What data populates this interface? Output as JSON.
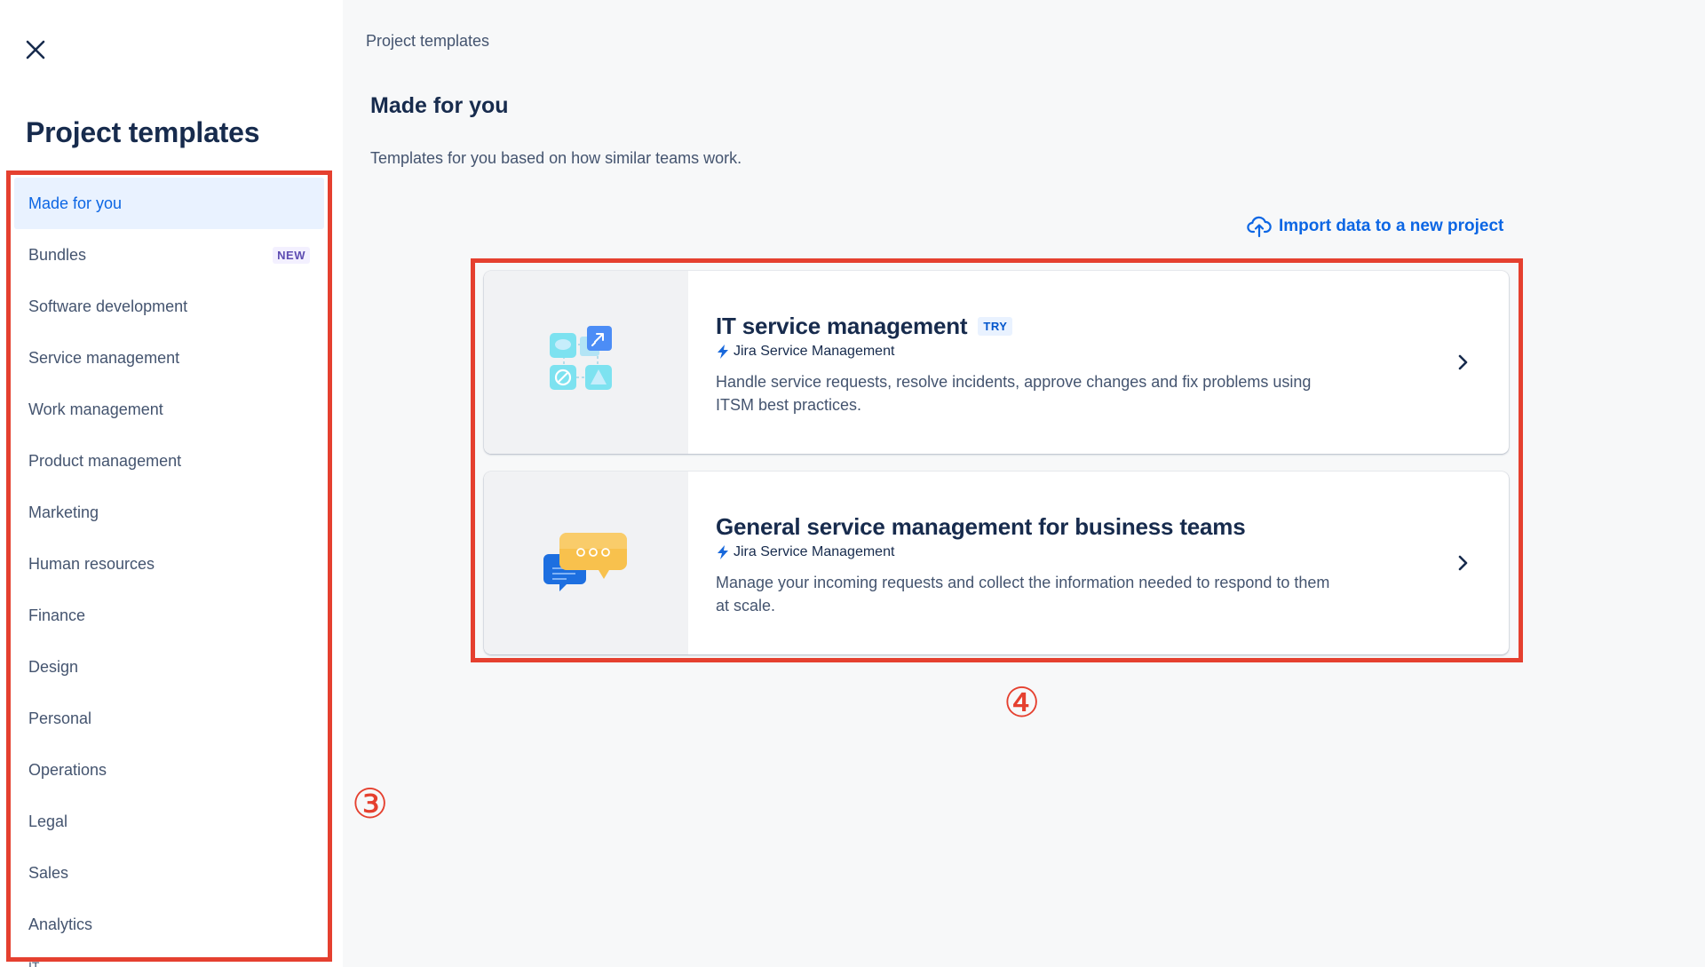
{
  "sidebar": {
    "title": "Project templates",
    "items": [
      {
        "label": "Made for you",
        "active": true
      },
      {
        "label": "Bundles",
        "badge": "NEW"
      },
      {
        "label": "Software development"
      },
      {
        "label": "Service management"
      },
      {
        "label": "Work management"
      },
      {
        "label": "Product management"
      },
      {
        "label": "Marketing"
      },
      {
        "label": "Human resources"
      },
      {
        "label": "Finance"
      },
      {
        "label": "Design"
      },
      {
        "label": "Personal"
      },
      {
        "label": "Operations"
      },
      {
        "label": "Legal"
      },
      {
        "label": "Sales"
      },
      {
        "label": "Analytics"
      }
    ],
    "overflow_label": "IT"
  },
  "main": {
    "breadcrumb": "Project templates",
    "title": "Made for you",
    "subtitle": "Templates for you based on how similar teams work.",
    "import_label": "Import data to a new project",
    "cards": [
      {
        "title": "IT service management",
        "badge": "TRY",
        "product": "Jira Service Management",
        "description": "Handle service requests, resolve incidents, approve changes and fix problems using ITSM best practices."
      },
      {
        "title": "General service management for business teams",
        "product": "Jira Service Management",
        "description": "Manage your incoming requests and collect the information needed to respond to them at scale."
      }
    ]
  },
  "annotations": {
    "sidebar_marker": "③",
    "cards_marker": "④"
  },
  "colors": {
    "accent": "#0C66E4",
    "annotation": "#E5402F",
    "active_bg": "#E9F2FF"
  }
}
